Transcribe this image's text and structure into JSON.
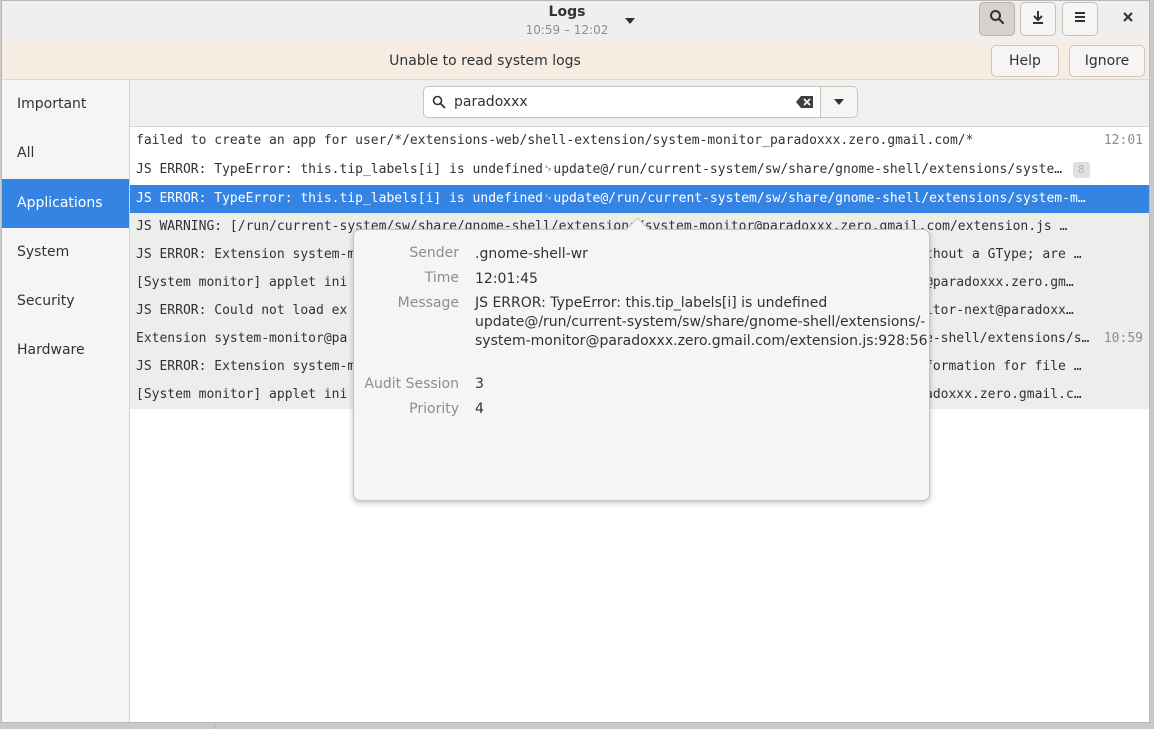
{
  "header": {
    "title": "Logs",
    "subtitle": "10:59 – 12:02",
    "icons": [
      "search-icon",
      "download-icon",
      "menu-icon",
      "close-icon"
    ]
  },
  "infobar": {
    "message": "Unable to read system logs",
    "help_label": "Help",
    "ignore_label": "Ignore"
  },
  "sidebar": {
    "items": [
      {
        "label": "Important"
      },
      {
        "label": "All"
      },
      {
        "label": "Applications"
      },
      {
        "label": "System"
      },
      {
        "label": "Security"
      },
      {
        "label": "Hardware"
      }
    ],
    "selected": "Applications"
  },
  "search": {
    "value": "paradoxxx"
  },
  "rows": [
    {
      "message": "failed to create an app for user/*/extensions-web/shell-extension/system-monitor_paradoxxx.zero.gmail.com/*",
      "time": "12:01"
    },
    {
      "message": "JS ERROR: TypeError: this.tip_labels[i] is undefined␊update@/run/current-system/sw/share/gnome-shell/extensions/system-monitor@paradoxxx.zero.gmail.com/extension.js:928:56",
      "badge": "8"
    },
    {
      "message": "JS ERROR: TypeError: this.tip_labels[i] is undefined␊update@/run/current-system/sw/share/gnome-shell/extensions/system-monitor@paradoxxx.zero.gmail.com/extension.js:928:56"
    },
    {
      "message": "JS WARNING: [/run/current-system/sw/share/gnome-shell/extensions/system-monitor@paradoxxx.zero.gmail.com/extension.js …"
    },
    {
      "message": "JS ERROR: Extension system-m",
      "tail": "thout a GType; are …"
    },
    {
      "message": "[System monitor] applet ini",
      "tail": "@paradoxxx.zero.gm…"
    },
    {
      "message": "JS ERROR: Could not load ex",
      "tail": "itor-next@paradoxx…"
    },
    {
      "message": "Extension system-monitor@pa",
      "tail": "e-shell/extensions/s…",
      "time": "10:59"
    },
    {
      "message": "JS ERROR: Extension system-m",
      "tail": "formation for file …"
    },
    {
      "message": "[System monitor] applet ini",
      "tail": "adoxxx.zero.gmail.c…"
    }
  ],
  "details": {
    "sender_label": "Sender",
    "sender": ".gnome-shell-wr",
    "time_label": "Time",
    "time": "12:01:45",
    "message_label": "Message",
    "message_line1": "JS ERROR: TypeError: this.tip_labels[i] is undefined",
    "message_line2": "update@/run/current-system/sw/share/gnome-shell/extensions/-",
    "message_line3": "system-monitor@paradoxxx.zero.gmail.com/extension.js:928:56",
    "audit_label": "Audit Session",
    "audit": "3",
    "priority_label": "Priority",
    "priority": "4"
  },
  "colors": {
    "accent": "#3584e4",
    "infobar": "#f6ece2",
    "headerbar": "#f0efee"
  }
}
